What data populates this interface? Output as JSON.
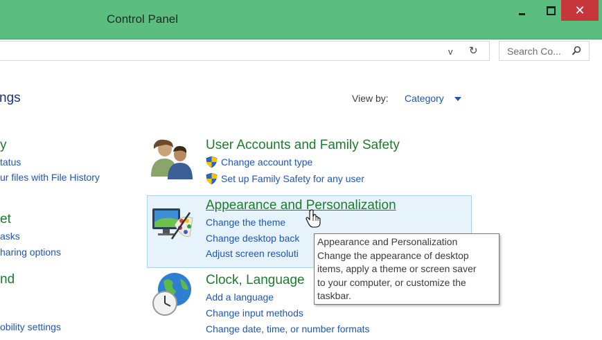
{
  "window": {
    "title": "Control Panel",
    "minimize_icon": "minimize-icon",
    "maximize_icon": "maximize-icon",
    "close_icon": "close-icon",
    "close_color": "#c7363b",
    "titlebar_color": "#5cbd80"
  },
  "address_bar": {
    "dropdown_glyph": "v",
    "refresh_glyph": "↻"
  },
  "search": {
    "placeholder": "Search Co...",
    "icon": "search-icon"
  },
  "heading": "ngs",
  "view_by": {
    "label": "View by:",
    "value": "Category"
  },
  "left_column": [
    {
      "title": "y",
      "links": [
        "tatus",
        "ur files with File History"
      ]
    },
    {
      "title": "et",
      "links": [
        "asks",
        "haring options"
      ]
    },
    {
      "title": "nd",
      "links": [
        "obility settings"
      ]
    }
  ],
  "categories": [
    {
      "title": "User Accounts and Family Safety",
      "icon": "users-icon",
      "links": [
        "Change account type",
        "Set up Family Safety for any user"
      ]
    },
    {
      "title": "Appearance and Personalization",
      "icon": "monitor-palette-icon",
      "links": [
        "Change the theme",
        "Change desktop back",
        "Adjust screen resoluti"
      ]
    },
    {
      "title": "Clock, Language",
      "icon": "globe-clock-icon",
      "links": [
        "Add a language",
        "Change input methods",
        "Change date, time, or number formats"
      ]
    }
  ],
  "tooltip": {
    "lines": [
      "Appearance and Personalization",
      "Change the appearance of desktop",
      "items, apply a theme or screen saver",
      "to your computer, or customize the",
      "taskbar."
    ]
  },
  "colors": {
    "link": "#1e56b4",
    "category_title": "#1e7a2e",
    "hover_bg": "#e6f3fb",
    "hover_border": "#a9d3ef"
  }
}
